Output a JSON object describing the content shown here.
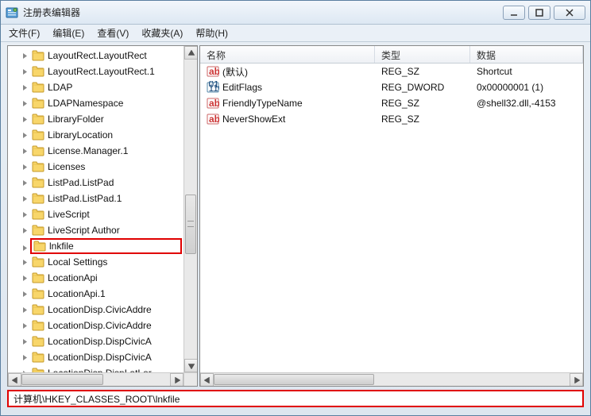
{
  "window": {
    "title": "注册表编辑器"
  },
  "menu": {
    "file": "文件(F)",
    "edit": "编辑(E)",
    "view": "查看(V)",
    "favorites": "收藏夹(A)",
    "help": "帮助(H)"
  },
  "tree": {
    "items": [
      {
        "label": "LayoutRect.LayoutRect"
      },
      {
        "label": "LayoutRect.LayoutRect.1"
      },
      {
        "label": "LDAP"
      },
      {
        "label": "LDAPNamespace"
      },
      {
        "label": "LibraryFolder"
      },
      {
        "label": "LibraryLocation"
      },
      {
        "label": "License.Manager.1"
      },
      {
        "label": "Licenses"
      },
      {
        "label": "ListPad.ListPad"
      },
      {
        "label": "ListPad.ListPad.1"
      },
      {
        "label": "LiveScript"
      },
      {
        "label": "LiveScript Author"
      },
      {
        "label": "lnkfile",
        "highlight": true
      },
      {
        "label": "Local Settings"
      },
      {
        "label": "LocationApi"
      },
      {
        "label": "LocationApi.1"
      },
      {
        "label": "LocationDisp.CivicAddre"
      },
      {
        "label": "LocationDisp.CivicAddre"
      },
      {
        "label": "LocationDisp.DispCivicA"
      },
      {
        "label": "LocationDisp.DispCivicA"
      },
      {
        "label": "LocationDisp.DispLatLor"
      }
    ]
  },
  "list": {
    "headers": {
      "name": "名称",
      "type": "类型",
      "data": "数据"
    },
    "rows": [
      {
        "name": "(默认)",
        "type": "REG_SZ",
        "data": "Shortcut",
        "icon": "string"
      },
      {
        "name": "EditFlags",
        "type": "REG_DWORD",
        "data": "0x00000001 (1)",
        "icon": "binary"
      },
      {
        "name": "FriendlyTypeName",
        "type": "REG_SZ",
        "data": "@shell32.dll,-4153",
        "icon": "string"
      },
      {
        "name": "NeverShowExt",
        "type": "REG_SZ",
        "data": "",
        "icon": "string"
      }
    ]
  },
  "status": {
    "path": "计算机\\HKEY_CLASSES_ROOT\\lnkfile"
  }
}
